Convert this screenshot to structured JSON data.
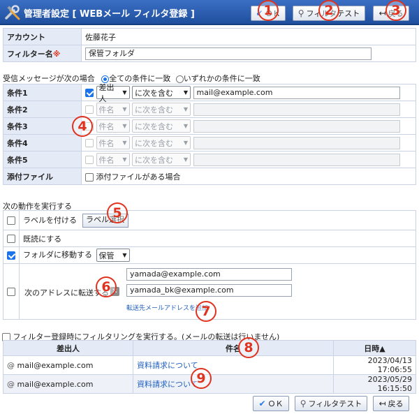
{
  "header": {
    "title": "管理者設定 [ WEBメール  フィルタ登録 ]",
    "ok_label": "ＯＫ",
    "test_label": "フィルタテスト",
    "back_label": "戻る"
  },
  "badges": [
    "1",
    "2",
    "3",
    "4",
    "5",
    "6",
    "7",
    "8",
    "9"
  ],
  "account": {
    "label": "アカウント",
    "value": "佐藤花子"
  },
  "filter_name": {
    "label": "フィルター名",
    "required_mark": "※",
    "value": "保管フォルダ"
  },
  "match": {
    "intro": "受信メッセージが次の場合",
    "option_all": "全ての条件に一致",
    "option_any": "いずれかの条件に一致"
  },
  "conditions": [
    {
      "label": "条件1",
      "field": "差出人",
      "op": "に次を含む",
      "value": "mail@example.com",
      "enabled": true
    },
    {
      "label": "条件2",
      "field": "件名",
      "op": "に次を含む",
      "value": "",
      "enabled": false
    },
    {
      "label": "条件3",
      "field": "件名",
      "op": "に次を含む",
      "value": "",
      "enabled": false
    },
    {
      "label": "条件4",
      "field": "件名",
      "op": "に次を含む",
      "value": "",
      "enabled": false
    },
    {
      "label": "条件5",
      "field": "件名",
      "op": "に次を含む",
      "value": "",
      "enabled": false
    }
  ],
  "attachment": {
    "label": "添付ファイル",
    "option": "添付ファイルがある場合"
  },
  "actions": {
    "intro": "次の動作を実行する",
    "label_action": "ラベルを付ける",
    "label_button": "ラベル選択",
    "read_action": "既読にする",
    "folder_action": "フォルダに移動する",
    "folder_value": "保管",
    "forward_action": "次のアドレスに転送する",
    "forward_addresses": [
      "yamada@example.com",
      "yamada_bk@example.com"
    ],
    "forward_add_link": "転送先メールアドレスを追加"
  },
  "run_on_register": "フィルター登録時にフィルタリングを実行する。(メールの転送は行いません)",
  "results": {
    "headers": {
      "from": "差出人",
      "subject": "件名",
      "date": "日時▲"
    },
    "rows": [
      {
        "icon": "@",
        "from": "mail@example.com",
        "subject": "資料請求について",
        "date": "2023/04/13 17:06:55"
      },
      {
        "icon": "@",
        "from": "mail@example.com",
        "subject": "資料請求について",
        "date": "2023/05/29 16:15:50"
      }
    ]
  },
  "footer": {
    "ok_label": "ＯＫ",
    "test_label": "フィルタテスト",
    "back_label": "戻る"
  },
  "colors": {
    "header": "#2a5cb0",
    "label_bg": "#e4ebf6",
    "badge": "#e0331f",
    "link": "#1f5fbf",
    "checkbox": "#1a73e8"
  }
}
